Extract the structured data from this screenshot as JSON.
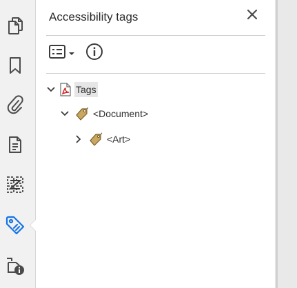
{
  "panel": {
    "title": "Accessibility tags",
    "close_icon": "close-icon",
    "toolbar": {
      "options_icon": "options-list-icon",
      "options_dropdown_icon": "caret-down-icon",
      "info_icon": "info-icon"
    }
  },
  "rail": {
    "items": [
      {
        "name": "page-thumbnails",
        "icon": "page-thumbnails-icon"
      },
      {
        "name": "bookmarks",
        "icon": "bookmark-icon"
      },
      {
        "name": "attachments",
        "icon": "paperclip-icon"
      },
      {
        "name": "content",
        "icon": "document-content-icon"
      },
      {
        "name": "order",
        "icon": "order-icon"
      },
      {
        "name": "accessibility-tags",
        "icon": "tag-icon",
        "active": true
      },
      {
        "name": "reading-order-info",
        "icon": "document-info-icon"
      }
    ],
    "accent_color": "#1473e6"
  },
  "tree": {
    "nodes": [
      {
        "label": "Tags",
        "level": 0,
        "expanded": true,
        "icon": "pdf-file-icon",
        "selected": true
      },
      {
        "label": "<Document>",
        "level": 1,
        "expanded": true,
        "icon": "tag-icon"
      },
      {
        "label": "<Art>",
        "level": 2,
        "expanded": false,
        "icon": "tag-icon"
      }
    ]
  }
}
